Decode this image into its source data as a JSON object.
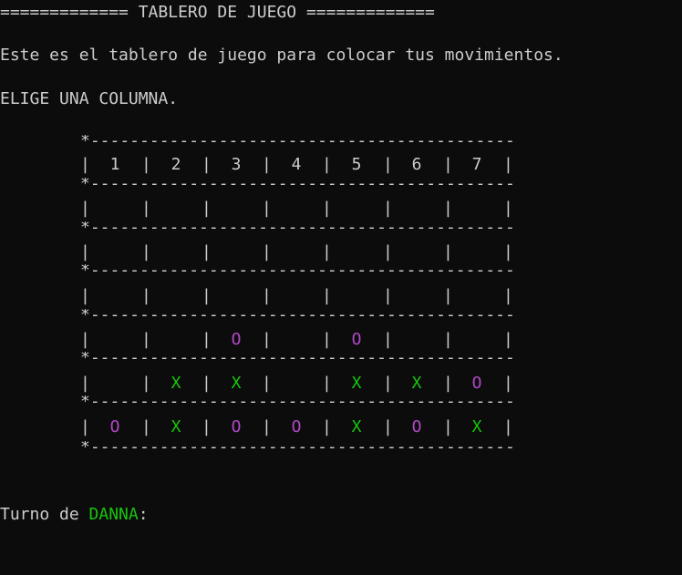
{
  "title": "============= TABLERO DE JUEGO =============",
  "intro": "Este es el tablero de juego para colocar tus movimientos.",
  "prompt": "ELIGE UNA COLUMNA.",
  "board": {
    "header": [
      "1",
      "2",
      "3",
      "4",
      "5",
      "6",
      "7"
    ],
    "rows": [
      [
        "",
        "",
        "",
        "",
        "",
        "",
        ""
      ],
      [
        "",
        "",
        "",
        "",
        "",
        "",
        ""
      ],
      [
        "",
        "",
        "",
        "",
        "",
        "",
        ""
      ],
      [
        "",
        "",
        "O",
        "",
        "O",
        "",
        ""
      ],
      [
        "",
        "X",
        "X",
        "",
        "X",
        "X",
        "O"
      ],
      [
        "O",
        "X",
        "O",
        "O",
        "X",
        "O",
        "X"
      ]
    ]
  },
  "turn": {
    "prefix": "Turno de ",
    "player": "DANNA",
    "suffix": ":"
  },
  "colors": {
    "background": "#0c0c0c",
    "text": "#cccccc",
    "player_x": "#16c60c",
    "player_o": "#b148c6"
  }
}
